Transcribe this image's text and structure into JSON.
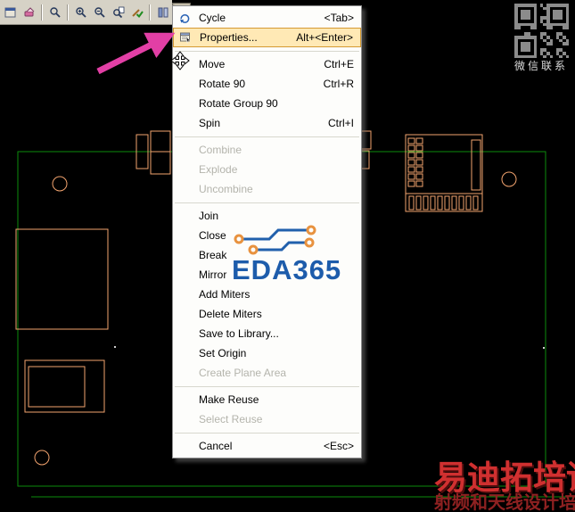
{
  "colors": {
    "board_outline_green": "#0c8b0c",
    "component_orange": "#f2a36e",
    "logo_blue": "#1d5cab",
    "arrow_pink": "#e23fa5",
    "brand_red": "#d03030",
    "brand_dark_red": "#8e2121",
    "menu_highlight_bg": "#ffe9b5",
    "menu_highlight_border": "#d59a33"
  },
  "toolbar": {
    "icons": [
      {
        "icon": "window-icon"
      },
      {
        "icon": "erase-icon"
      },
      {
        "type": "separator"
      },
      {
        "icon": "zoom-icon"
      },
      {
        "type": "separator"
      },
      {
        "icon": "zoom-in-icon"
      },
      {
        "icon": "zoom-out-icon"
      },
      {
        "icon": "zoom-sheet-icon"
      },
      {
        "icon": "verify-icon"
      },
      {
        "type": "separator"
      },
      {
        "icon": "design-toolbar-icon"
      },
      {
        "icon": "route-toolbar-icon",
        "state": "pressed"
      }
    ]
  },
  "context_menu": {
    "items": [
      {
        "label": "Cycle",
        "shortcut": "<Tab>",
        "icon": "cycle-icon"
      },
      {
        "label": "Properties...",
        "shortcut": "Alt+<Enter>",
        "icon": "properties-icon",
        "state": "highlighted"
      },
      {
        "type": "separator"
      },
      {
        "label": "Move",
        "shortcut": "Ctrl+E"
      },
      {
        "label": "Rotate 90",
        "shortcut": "Ctrl+R"
      },
      {
        "label": "Rotate Group 90"
      },
      {
        "label": "Spin",
        "shortcut": "Ctrl+I"
      },
      {
        "type": "separator"
      },
      {
        "label": "Combine",
        "state": "disabled"
      },
      {
        "label": "Explode",
        "state": "disabled"
      },
      {
        "label": "Uncombine",
        "state": "disabled"
      },
      {
        "type": "separator"
      },
      {
        "label": "Join"
      },
      {
        "label": "Close"
      },
      {
        "label": "Break"
      },
      {
        "label": "Mirror"
      },
      {
        "label": "Add Miters"
      },
      {
        "label": "Delete Miters"
      },
      {
        "label": "Save to Library..."
      },
      {
        "label": "Set Origin"
      },
      {
        "label": "Create Plane Area",
        "state": "disabled"
      },
      {
        "type": "separator"
      },
      {
        "label": "Make Reuse"
      },
      {
        "label": "Select Reuse",
        "state": "disabled"
      },
      {
        "type": "separator"
      },
      {
        "label": "Cancel",
        "shortcut": "<Esc>"
      }
    ]
  },
  "watermarks": {
    "logo_text": "EDA365",
    "qr_label": "微信联系",
    "brand_line1": "易迪拓培训",
    "brand_line2": "射频和天线设计培训专家"
  }
}
